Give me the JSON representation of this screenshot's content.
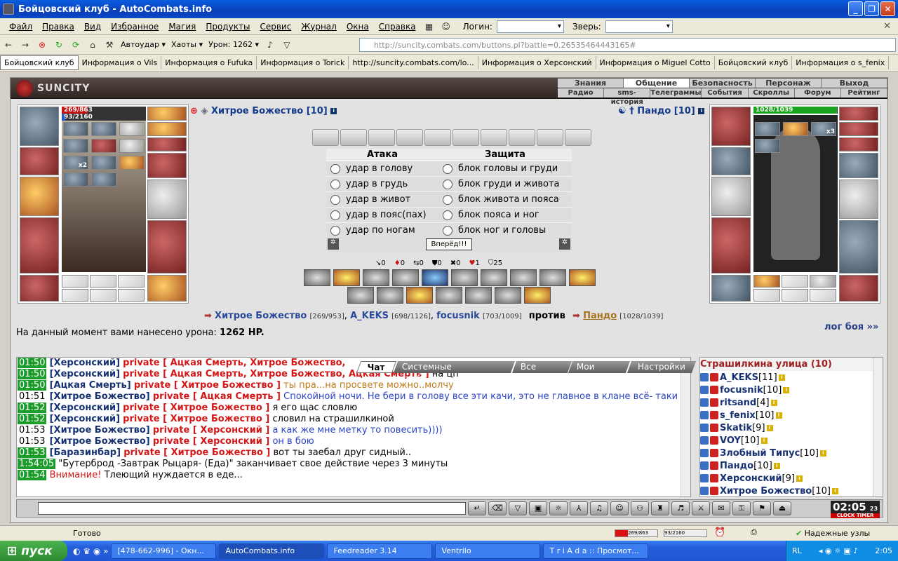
{
  "window": {
    "title": "Бойцовский клуб - AutoCombats.info",
    "min": "_",
    "max": "❐",
    "close": "✕"
  },
  "menu": [
    "Файл",
    "Правка",
    "Вид",
    "Избранное",
    "Магия",
    "Продукты",
    "Сервис",
    "Журнал",
    "Окна",
    "Справка"
  ],
  "login": {
    "label": "Логин:",
    "pet_label": "Зверь:"
  },
  "nav": {
    "autoudar": "Автоудар",
    "haoty": "Хаоты",
    "uron": "Урон: 1262",
    "address": "http://suncity.combats.com/buttons.pl?battle=0.26535464443165#"
  },
  "tabs": [
    "Бойцовский клуб",
    "Информация о Vils",
    "Информация о Fufuka",
    "Информация о Torick",
    "http://suncity.combats.com/lo...",
    "Информация о Херсонский",
    "Информация о Miguel Cotto",
    "Бойцовский клуб",
    "Информация о s_fenix"
  ],
  "game": {
    "logo": "SUNCITY",
    "topnav1": [
      "Знания",
      "Общение",
      "Безопасность",
      "Персонаж",
      "Выход"
    ],
    "topnav2": [
      "Радио",
      "sms-история",
      "Телеграммы",
      "События",
      "Скроллы",
      "Форум",
      "Рейтинг"
    ],
    "player": {
      "name": "Хитрое Божество [10]",
      "hp": "269/863",
      "mana": "93/2160",
      "hp_frac": 0.31,
      "mana_frac": 0.04
    },
    "enemy": {
      "name": "Пандо [10]",
      "hp": "1028/1039",
      "hp_frac": 0.99
    },
    "x2": "x2",
    "x3": "x3",
    "attack": {
      "title": "Атака",
      "options": [
        "удар в голову",
        "удар в грудь",
        "удар в живот",
        "удар в пояс(пах)",
        "удар по ногам"
      ]
    },
    "defense": {
      "title": "Защита",
      "options": [
        "блок головы и груди",
        "блок груди и живота",
        "блок живота и пояса",
        "блок пояса и ног",
        "блок ног и головы"
      ]
    },
    "fight_button": "Вперёд!!!",
    "counters": [
      {
        "icon": "↘",
        "v": "0"
      },
      {
        "icon": "♦",
        "v": "0"
      },
      {
        "icon": "⇆",
        "v": "0"
      },
      {
        "icon": "⛊",
        "v": "0"
      },
      {
        "icon": "✖",
        "v": "0"
      },
      {
        "icon": "♥",
        "v": "1"
      },
      {
        "icon": "⛉",
        "v": "25"
      }
    ],
    "teams": {
      "p1": "Хитрое Божество",
      "p1hp": "[269/953]",
      "p2": "A_KEKS",
      "p2hp": "[698/1126]",
      "p3": "focusnik",
      "p3hp": "[703/1009]",
      "vs": "против",
      "e1": "Пандо",
      "e1hp": "[1028/1039]"
    },
    "damage": {
      "text": "На данный момент вами нанесено урона:",
      "value": "1262 HP."
    },
    "log_link": "лог боя »»"
  },
  "chat": {
    "tabs": [
      "Чат",
      "Системные сообщения",
      "Все логи",
      "Мои логи",
      "Настройки"
    ],
    "lines": [
      {
        "t": "01:50",
        "g": true,
        "n": "[Херсонский]",
        "p": "private [ Ацкая Смерть, Хитрое Божество,",
        "m": ""
      },
      {
        "t": "01:50",
        "g": true,
        "n": "[Херсонский]",
        "p": "private [ Ацкая Смерть, Хитрое Божество, Ацкая Смерть ]",
        "m": "на цп"
      },
      {
        "t": "01:50",
        "g": true,
        "n": "[Ацкая Смерть]",
        "p": "private [ Хитрое Божество ]",
        "m": "ты пра...на просвете можно..молчу",
        "mc": "org"
      },
      {
        "t": "01:51",
        "g": false,
        "n": "[Хитрое Божество]",
        "p": "private [ Ацкая Смерть ]",
        "m": "Спокойной ночи. Не бери в голову все эти качи, это не главное в клане всё- таки",
        "mc": "blu",
        "wrap": true
      },
      {
        "t": "01:52",
        "g": true,
        "n": "[Херсонский]",
        "p": "private [ Хитрое Божество ]",
        "m": "я его щас словлю"
      },
      {
        "t": "01:52",
        "g": true,
        "n": "[Херсонский]",
        "p": "private [ Хитрое Божество ]",
        "m": "словил на страшилкиной"
      },
      {
        "t": "01:53",
        "g": false,
        "n": "[Хитрое Божество]",
        "p": "private [ Херсонский ]",
        "m": "а как же мне метку то повесить))))",
        "mc": "blu"
      },
      {
        "t": "01:53",
        "g": false,
        "n": "[Хитрое Божество]",
        "p": "private [ Херсонский ]",
        "m": "он в бою",
        "mc": "blu"
      },
      {
        "t": "01:53",
        "g": true,
        "n": "[Баразинбар]",
        "p": "private [ Хитрое Божество ]",
        "m": "вот ты заебал друг сидный.."
      },
      {
        "t": "1:54:05",
        "g": true,
        "n": "",
        "p": "",
        "m": "\"Бутерброд -Завтрак Рыцаря- (Еда)\" заканчивает свое действие через 3 минуты"
      },
      {
        "t": "01:54",
        "g": true,
        "n": "",
        "p": "",
        "w": "Внимание!",
        "m": "Тлеющий нуждается в еде..."
      }
    ]
  },
  "roster": {
    "title": "Страшилкина улица (10)",
    "items": [
      {
        "n": "A_KEKS",
        "l": "[11]"
      },
      {
        "n": "focusnik",
        "l": "[10]"
      },
      {
        "n": "ritsand",
        "l": "[4]"
      },
      {
        "n": "s_fenix",
        "l": "[10]"
      },
      {
        "n": "Skatik",
        "l": "[9]"
      },
      {
        "n": "VOY",
        "l": "[10]"
      },
      {
        "n": "Злобный Типус",
        "l": "[10]"
      },
      {
        "n": "Пандо",
        "l": "[10]"
      },
      {
        "n": "Херсонский",
        "l": "[9]"
      },
      {
        "n": "Хитрое Божество",
        "l": "[10]"
      }
    ]
  },
  "clock": {
    "time": "02:05",
    "sec": "23",
    "label": "CLOCK TIMER"
  },
  "status": {
    "ready": "Готово",
    "hp": "269/863",
    "mana": "93/2160",
    "secure": "Надежные узлы"
  },
  "taskbar": {
    "start": "пуск",
    "tasks": [
      "[478-662-996] - Окн...",
      "AutoCombats.info",
      "Feedreader 3.14",
      "Ventrilo",
      "T r i A d a :: Просмот..."
    ],
    "lang": "RL",
    "time": "2:05"
  }
}
